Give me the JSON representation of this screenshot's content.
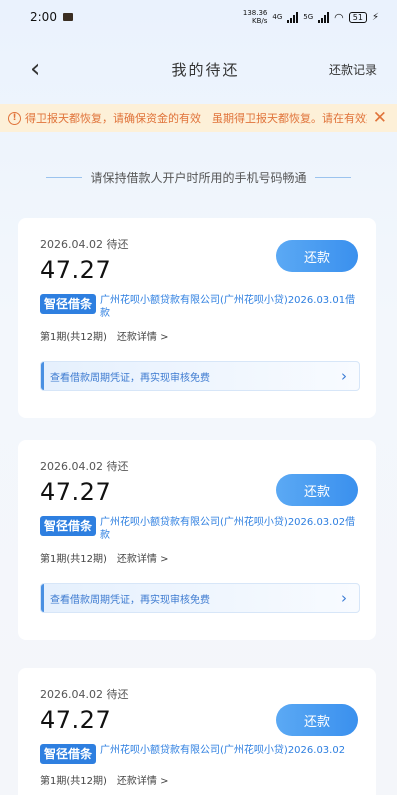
{
  "status_bar": {
    "time": "2:00",
    "net_speed_value": "138.36",
    "net_speed_unit": "KB/s",
    "network_types": [
      "4G",
      "5G"
    ],
    "battery": "51"
  },
  "header": {
    "title": "我的待还",
    "right_link": "还款记录"
  },
  "notice": {
    "text": "得卫报天都恢复，请确保资金的有效　虽期得卫报天都恢复。请在有效期",
    "accent_color": "#e0733a"
  },
  "tip": "请保持借款人开户时所用的手机号码畅通",
  "loans": [
    {
      "due_label": "2026.04.02 待还",
      "amount": "47.27",
      "repay_label": "还款",
      "brand": "智径借条",
      "lender": "广州花呗小额贷款有限公司(广州花呗小贷)2026.03.01借款",
      "period": "第1期(共12期)　还款详情 >",
      "voucher": "查看借款周期凭证，再实现审核免费"
    },
    {
      "due_label": "2026.04.02 待还",
      "amount": "47.27",
      "repay_label": "还款",
      "brand": "智径借条",
      "lender": "广州花呗小额贷款有限公司(广州花呗小贷)2026.03.02借款",
      "period": "第1期(共12期)　还款详情 >",
      "voucher": "查看借款周期凭证，再实现审核免费"
    },
    {
      "due_label": "2026.04.02 待还",
      "amount": "47.27",
      "repay_label": "还款",
      "brand": "智径借条",
      "lender": "广州花呗小额贷款有限公司(广州花呗小贷)2026.03.02",
      "period": "第1期(共12期)　还款详情 >",
      "voucher": ""
    }
  ],
  "colors": {
    "primary": "#3a90ee",
    "brand_badge": "#2e7fe0",
    "notice_bg": "#fdf0d8"
  }
}
